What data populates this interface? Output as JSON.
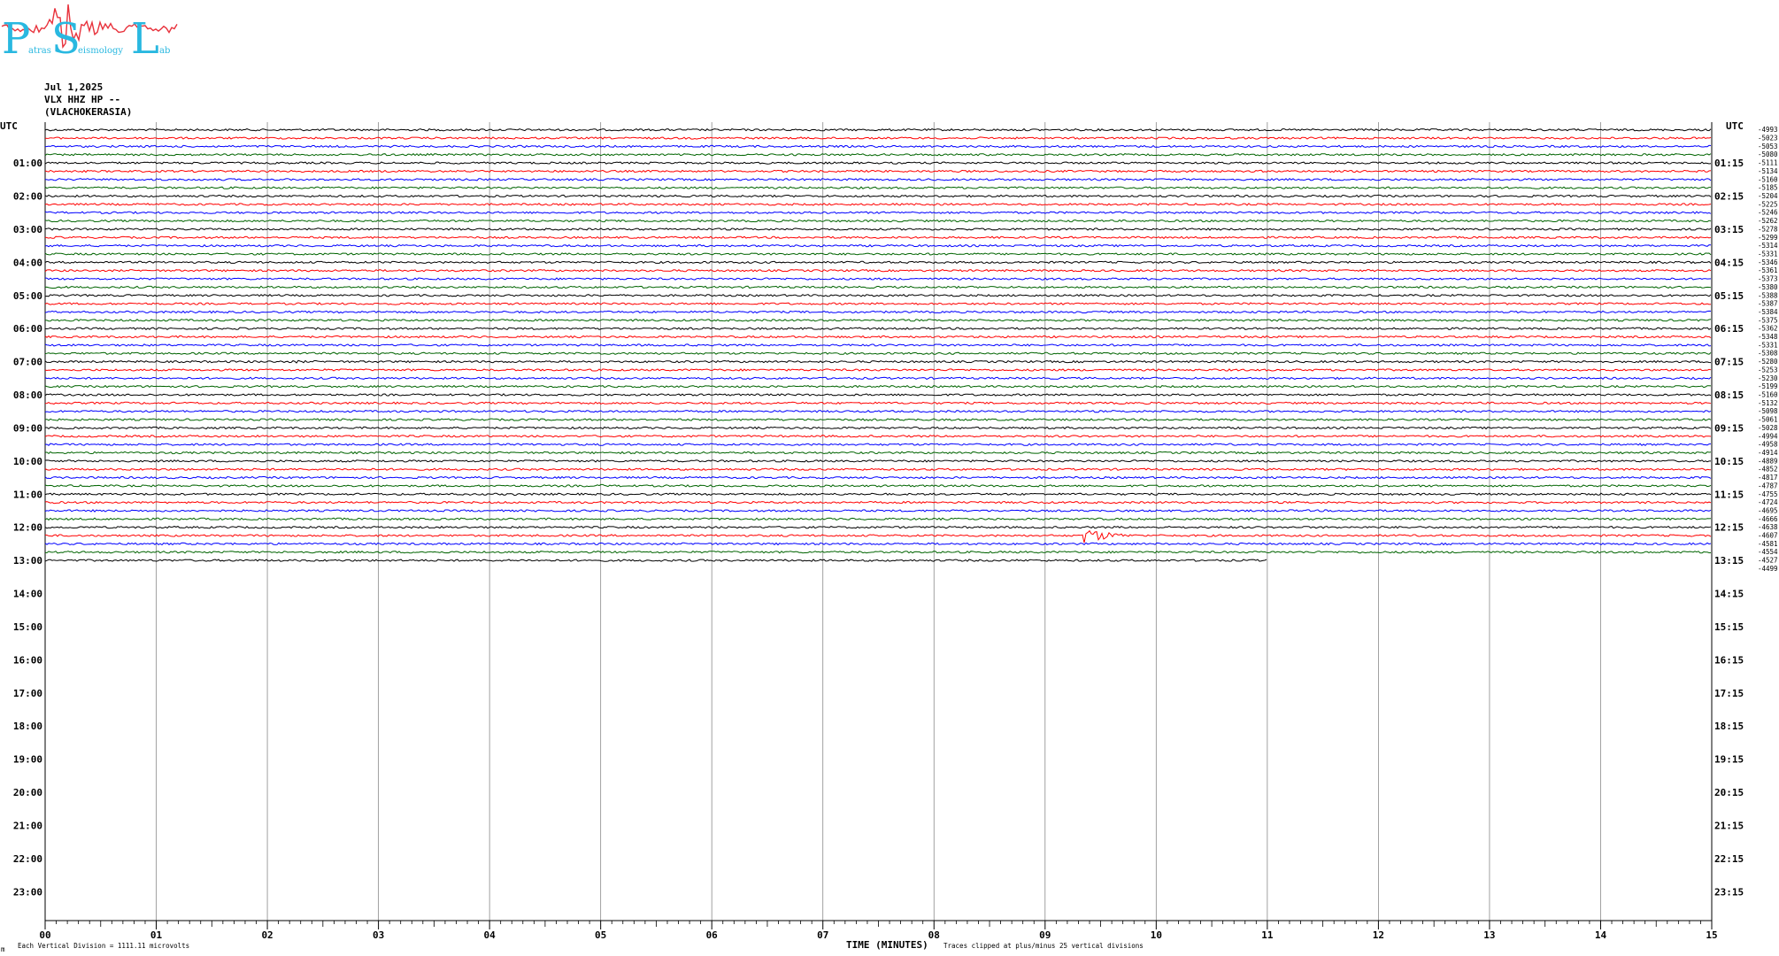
{
  "logo": {
    "letters": [
      "P",
      "S",
      "L"
    ],
    "words": [
      "atras",
      "eismology",
      "ab"
    ],
    "color": "#29b8e0",
    "wave_color": "#e8323c"
  },
  "header": {
    "date": "Jul 1,2025",
    "channel": "VLX HHZ HP --",
    "station": "(VLACHOKERASIA)"
  },
  "left_corner_label": "UTC",
  "right_corner_label": "UTC",
  "footer": {
    "scale_note": "Each Vertical Division = 1111.11 microvolts",
    "x_title": "TIME (MINUTES)",
    "clip_note": "Traces clipped at plus/minus 25 vertical divisions",
    "corner_mark": "m"
  },
  "chart_data": {
    "type": "line",
    "title": "",
    "xlabel": "TIME (MINUTES)",
    "ylabel": "",
    "xlim": [
      0,
      15
    ],
    "x_ticks": [
      "00",
      "01",
      "02",
      "03",
      "04",
      "05",
      "06",
      "07",
      "08",
      "09",
      "10",
      "11",
      "12",
      "13",
      "14",
      "15"
    ],
    "grid_vertical": true,
    "trace_interval_minutes": 15,
    "traces_per_hour": 4,
    "total_rows": 96,
    "recorded_rows": 53,
    "last_row_end_minute": 11,
    "trace_colors": [
      "#000000",
      "#ff0000",
      "#0000ff",
      "#006400"
    ],
    "left_hour_labels": [
      "01:00",
      "02:00",
      "03:00",
      "04:00",
      "05:00",
      "06:00",
      "07:00",
      "08:00",
      "09:00",
      "10:00",
      "11:00",
      "12:00",
      "13:00",
      "14:00",
      "15:00",
      "16:00",
      "17:00",
      "18:00",
      "19:00",
      "20:00",
      "21:00",
      "22:00",
      "23:00"
    ],
    "right_hour_labels": [
      "01:15",
      "02:15",
      "03:15",
      "04:15",
      "05:15",
      "06:15",
      "07:15",
      "08:15",
      "09:15",
      "10:15",
      "11:15",
      "12:15",
      "13:15",
      "14:15",
      "15:15",
      "16:15",
      "17:15",
      "18:15",
      "19:15",
      "20:15",
      "21:15",
      "22:15",
      "23:15"
    ],
    "offset_values": [
      "-4993",
      "-5023",
      "-5053",
      "-5080",
      "-5111",
      "-5134",
      "-5160",
      "-5185",
      "-5204",
      "-5225",
      "-5246",
      "-5262",
      "-5278",
      "-5299",
      "-5314",
      "-5331",
      "-5346",
      "-5361",
      "-5373",
      "-5380",
      "-5388",
      "-5387",
      "-5384",
      "-5375",
      "-5362",
      "-5348",
      "-5331",
      "-5308",
      "-5280",
      "-5253",
      "-5230",
      "-5199",
      "-5160",
      "-5132",
      "-5098",
      "-5061",
      "-5028",
      "-4994",
      "-4958",
      "-4914",
      "-4889",
      "-4852",
      "-4817",
      "-4787",
      "-4755",
      "-4724",
      "-4695",
      "-4666",
      "-4638",
      "-4607",
      "-4581",
      "-4554",
      "-4527",
      "-4499"
    ],
    "events": [
      {
        "row": 24,
        "start_min": 12.1,
        "end_min": 12.5,
        "amp": 1.3
      },
      {
        "row": 21,
        "start_min": 12.8,
        "end_min": 12.9,
        "amp": 1.8
      },
      {
        "row": 28,
        "start_min": 2.2,
        "end_min": 3.2,
        "amp": 1.8
      },
      {
        "row": 32,
        "start_min": 0.6,
        "end_min": 0.9,
        "amp": 1.5
      },
      {
        "row": 41,
        "start_min": 3.1,
        "end_min": 3.2,
        "amp": 1.5
      },
      {
        "row": 43,
        "start_min": 5.0,
        "end_min": 5.3,
        "amp": 2.0
      },
      {
        "row": 44,
        "start_min": 4.2,
        "end_min": 4.9,
        "amp": 1.5
      },
      {
        "row": 49,
        "start_min": 9.35,
        "end_min": 9.9,
        "amp": 10.0
      }
    ]
  }
}
